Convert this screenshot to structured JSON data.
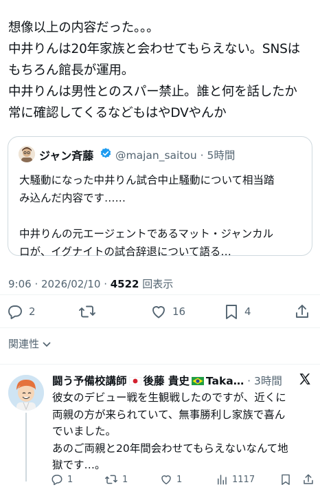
{
  "tweet": {
    "lines": [
      "想像以上の内容だった。。。",
      "中井りんは20年家族と会わせてもらえない。SNSは",
      "もちろん館長が運用。",
      "中井りんは男性とのスパー禁止。誰と何を話したか",
      "常に確認してくるなどもはやDVやんか"
    ]
  },
  "quote": {
    "name": "ジャン斉藤",
    "handle": "@majan_saitou · 5時間",
    "lines": [
      "大騒動になった中井りん試合中止騒動について相当踏",
      "み込んだ内容です……",
      "",
      "中井りんの元エージェントであるマット・ジャンカル",
      "ロが、イグナイトの試合辞退について語る…"
    ]
  },
  "meta": {
    "time": "9:06 · 2026/02/10 · ",
    "views_count": "4522",
    "views_label": " 回表示"
  },
  "actions": {
    "reply_count": "2",
    "repost_count": "",
    "like_count": "16",
    "bookmark_count": "4"
  },
  "related": {
    "label": "関連性"
  },
  "reply": {
    "name_prefix": "闘う予備校講師",
    "name_middle": "後藤 貴史",
    "name_suffix": "Taka…",
    "time": " · 3時間",
    "lines": [
      "彼女のデビュー戦を生観戦したのですが、近くに",
      "両親の方が来られていて、無事勝利し家族で喜ん",
      "でいました。",
      "あのご両親と20年間会わせてもらえないなんて地",
      "獄です…。"
    ],
    "reply_count": "1",
    "repost_count": "1",
    "like_count": "1",
    "views_count": "1117"
  },
  "colors": {
    "accent": "#1d9bf0",
    "secondary_text": "#536471",
    "border": "#cfd9de"
  }
}
